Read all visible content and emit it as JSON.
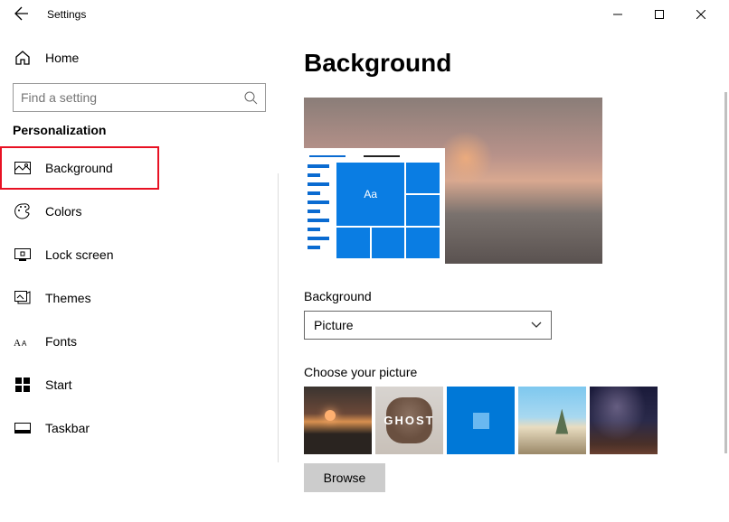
{
  "titlebar": {
    "title": "Settings"
  },
  "sidebar": {
    "home": "Home",
    "search_placeholder": "Find a setting",
    "section": "Personalization",
    "items": [
      {
        "label": "Background",
        "selected": true
      },
      {
        "label": "Colors"
      },
      {
        "label": "Lock screen"
      },
      {
        "label": "Themes"
      },
      {
        "label": "Fonts"
      },
      {
        "label": "Start"
      },
      {
        "label": "Taskbar"
      }
    ]
  },
  "main": {
    "heading": "Background",
    "preview_sample_text": "Aa",
    "bg_label": "Background",
    "bg_value": "Picture",
    "choose_label": "Choose your picture",
    "thumb_ghost": "GHOST",
    "browse": "Browse"
  }
}
